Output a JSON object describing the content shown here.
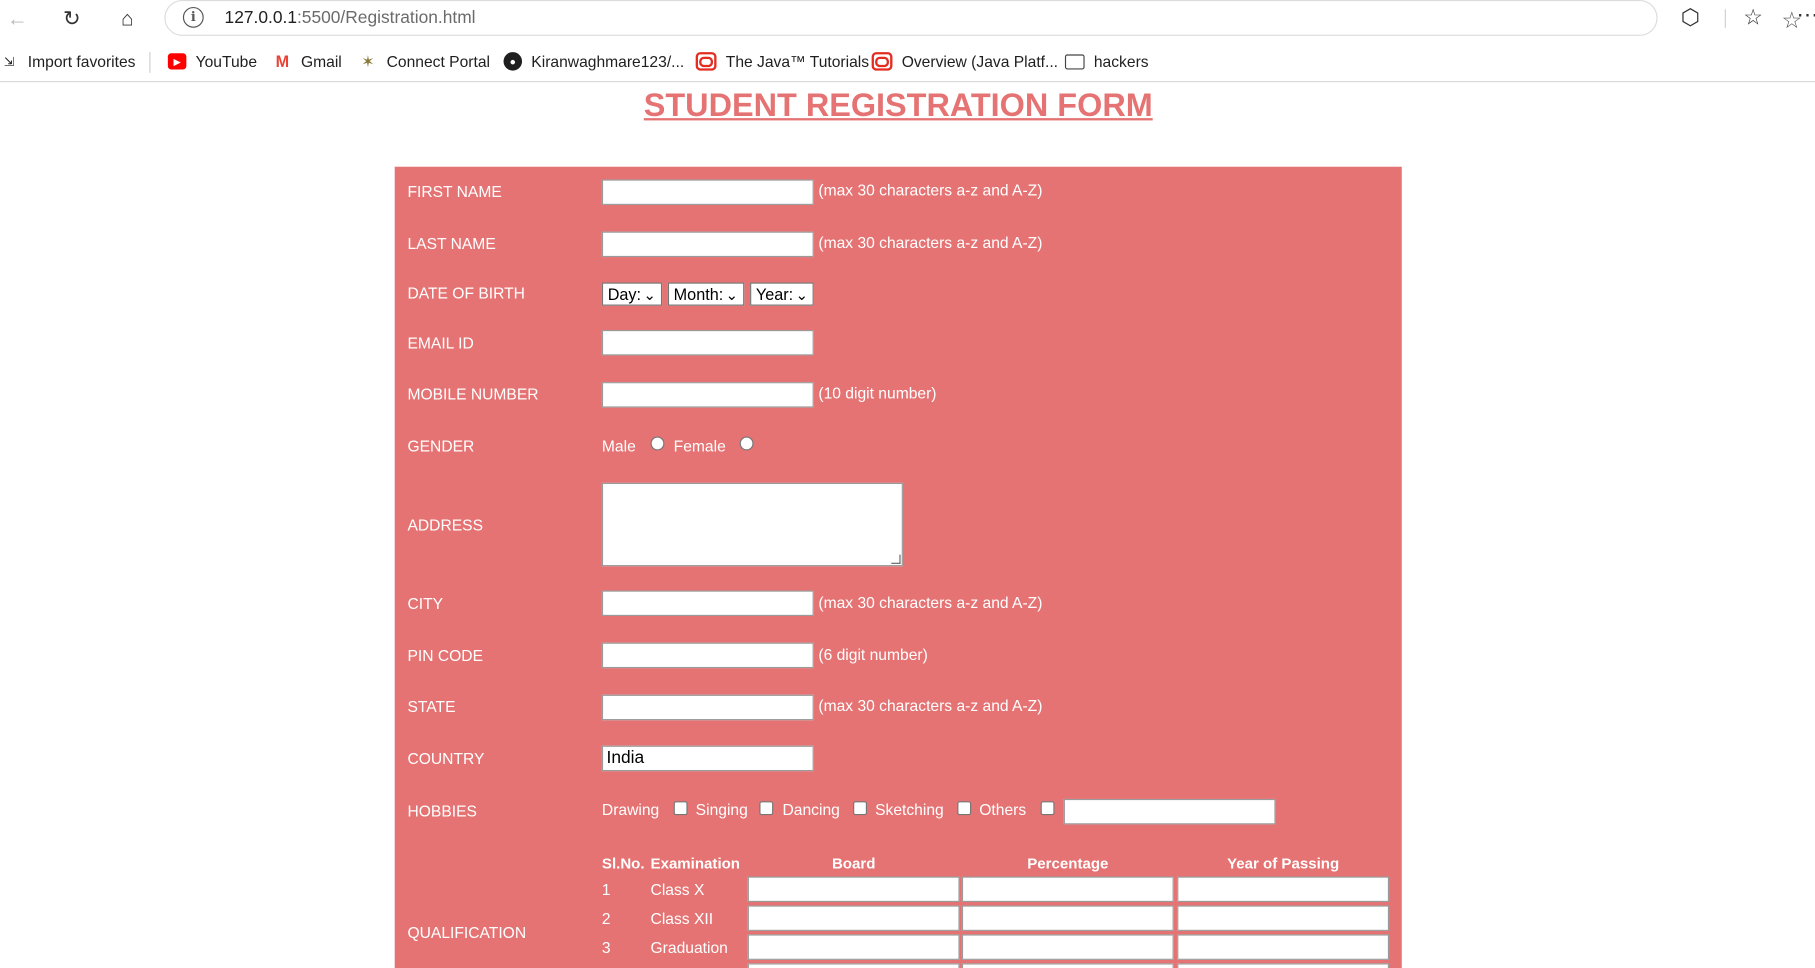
{
  "browser": {
    "url_host": "127.0.0.1",
    "url_path": ":5500/Registration.html",
    "favorites": [
      {
        "label": "Import favorites",
        "icon": "import-icon"
      },
      {
        "label": "YouTube",
        "icon": "youtube-icon"
      },
      {
        "label": "Gmail",
        "icon": "gmail-icon"
      },
      {
        "label": "Connect Portal",
        "icon": "portal-icon"
      },
      {
        "label": "Kiranwaghmare123/...",
        "icon": "github-icon"
      },
      {
        "label": "The Java™ Tutorials",
        "icon": "oracle-icon"
      },
      {
        "label": "Overview (Java Platf...",
        "icon": "oracle-icon"
      },
      {
        "label": "hackers",
        "icon": "folder-icon"
      }
    ]
  },
  "page": {
    "title": "STUDENT REGISTRATION FORM",
    "accent_color": "#e57373"
  },
  "form": {
    "first_name": {
      "label": "FIRST NAME",
      "hint": "(max 30 characters a-z and A-Z)",
      "value": ""
    },
    "last_name": {
      "label": "LAST NAME",
      "hint": "(max 30 characters a-z and A-Z)",
      "value": ""
    },
    "dob": {
      "label": "DATE OF BIRTH",
      "day": "Day:",
      "month": "Month:",
      "year": "Year:"
    },
    "email": {
      "label": "EMAIL ID",
      "value": ""
    },
    "mobile": {
      "label": "MOBILE NUMBER",
      "hint": "(10 digit number)",
      "value": ""
    },
    "gender": {
      "label": "GENDER",
      "male": "Male",
      "female": "Female"
    },
    "address": {
      "label": "ADDRESS"
    },
    "city": {
      "label": "CITY",
      "hint": "(max 30 characters a-z and A-Z)",
      "value": ""
    },
    "pin": {
      "label": "PIN CODE",
      "hint": "(6 digit number)",
      "value": ""
    },
    "state": {
      "label": "STATE",
      "hint": "(max 30 characters a-z and A-Z)",
      "value": ""
    },
    "country": {
      "label": "COUNTRY",
      "value": "India"
    },
    "hobbies": {
      "label": "HOBBIES",
      "options": [
        "Drawing",
        "Singing",
        "Dancing",
        "Sketching",
        "Others"
      ]
    },
    "qualification": {
      "label": "QUALIFICATION",
      "headers": {
        "slno": "Sl.No.",
        "exam": "Examination",
        "board": "Board",
        "percentage": "Percentage",
        "year": "Year of Passing"
      },
      "rows": [
        {
          "num": "1",
          "exam": "Class X"
        },
        {
          "num": "2",
          "exam": "Class XII"
        },
        {
          "num": "3",
          "exam": "Graduation"
        }
      ]
    }
  }
}
